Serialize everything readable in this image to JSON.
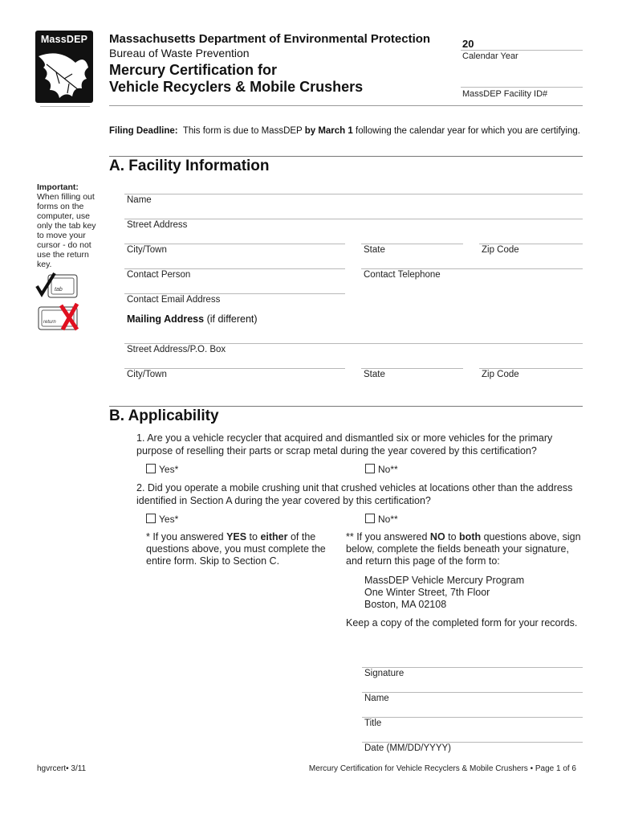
{
  "header": {
    "logo_text": "MassDEP",
    "agency": "Massachusetts Department of Environmental Protection",
    "bureau": "Bureau of Waste Prevention",
    "title_line1": "Mercury Certification for",
    "title_line2": "Vehicle Recyclers & Mobile Crushers",
    "year_prefix": "20",
    "calendar_year_label": "Calendar Year",
    "facility_id_label": "MassDEP Facility ID#"
  },
  "deadline": {
    "label": "Filing Deadline:",
    "text1": "This form is due to MassDEP",
    "bold": "by March 1",
    "text2": "following the calendar year for which you are certifying."
  },
  "sidebar": {
    "important_label": "Important:",
    "note": "When filling out forms on the computer, use only the tab key to move your cursor - do not use the return key.",
    "tab_key_label": "tab",
    "return_key_label": "return"
  },
  "section_a": {
    "title": "A. Facility Information",
    "fields": {
      "name": "Name",
      "street": "Street Address",
      "city": "City/Town",
      "state": "State",
      "zip": "Zip Code",
      "contact_person": "Contact Person",
      "contact_phone": "Contact Telephone",
      "contact_email": "Contact Email Address"
    },
    "mailing": {
      "title_bold": "Mailing Address",
      "title_rest": "(if different)",
      "street": "Street Address/P.O. Box",
      "city": "City/Town",
      "state": "State",
      "zip": "Zip Code"
    }
  },
  "section_b": {
    "title": "B. Applicability",
    "q1": "1. Are you a vehicle recycler that acquired and dismantled six or more vehicles for the primary purpose of reselling their parts or scrap metal during the year covered by this certification?",
    "q2": "2. Did you operate a mobile crushing unit that crushed vehicles at locations other than the address identified in Section A during the year covered by this certification?",
    "yes_label": "Yes*",
    "no_label": "No**",
    "yes_note": {
      "t1": "*  If you answered ",
      "b1": "YES",
      "t2": " to ",
      "b2": "either",
      "t3": " of the questions above, you must complete the entire form.  Skip to Section C."
    },
    "no_note": {
      "t1": "** If you answered ",
      "b1": "NO",
      "t2": " to ",
      "b2": "both",
      "t3": " questions above, sign below, complete the fields beneath your signature, and return this page of the form to:"
    },
    "address": {
      "line1": "MassDEP Vehicle Mercury Program",
      "line2": "One Winter Street, 7th Floor",
      "line3": "Boston, MA 02108"
    },
    "keep_copy": "Keep a copy of the completed form for your records.",
    "signature_fields": {
      "signature": "Signature",
      "name": "Name",
      "title": "Title",
      "date": "Date (MM/DD/YYYY)"
    }
  },
  "footer": {
    "left": "hgvrcert• 3/11",
    "right": "Mercury Certification for Vehicle Recyclers & Mobile Crushers • Page 1 of 6"
  }
}
